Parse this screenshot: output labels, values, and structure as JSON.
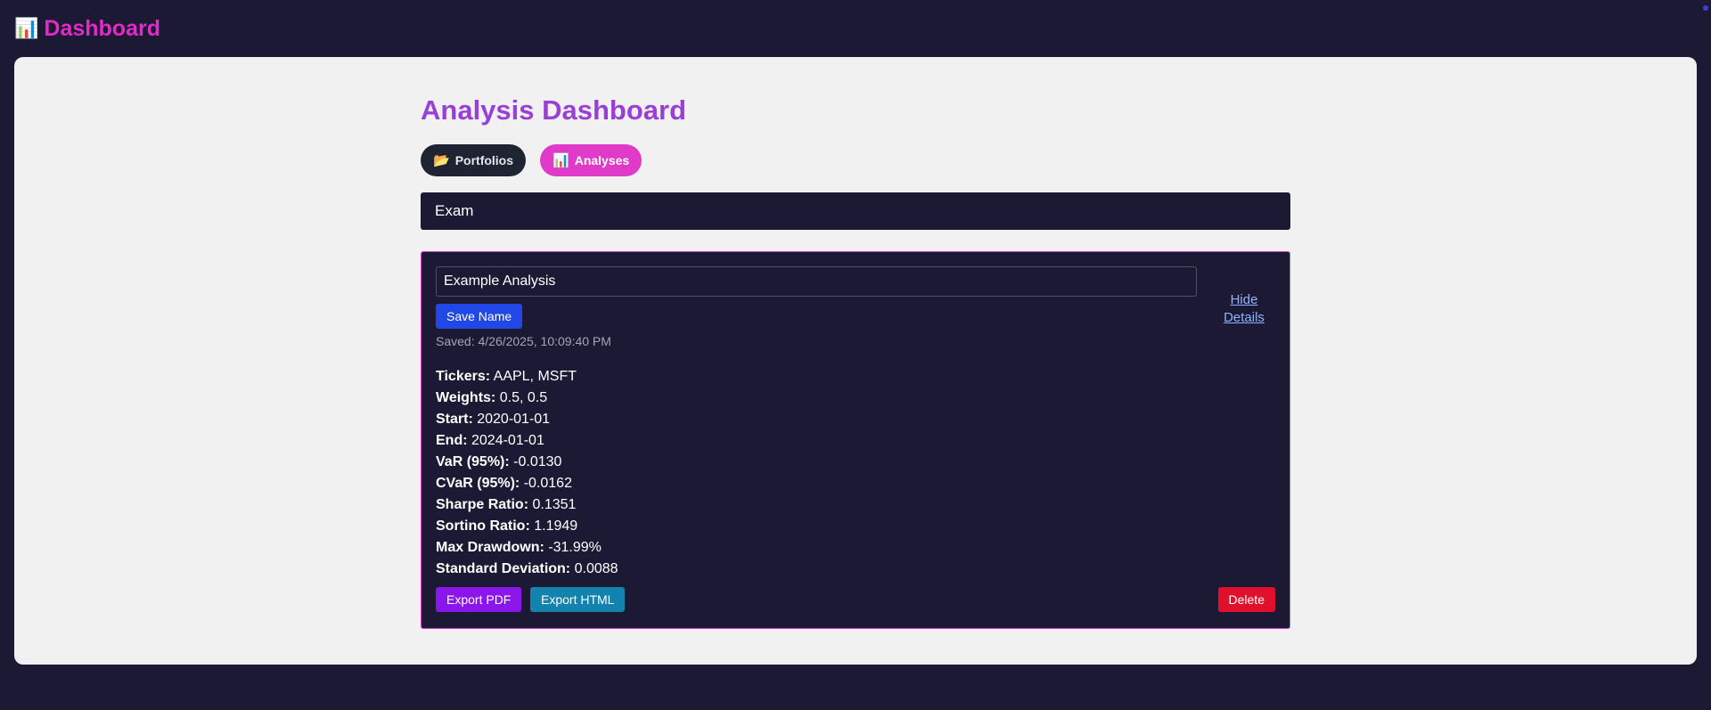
{
  "header": {
    "icon": "bar-chart-icon",
    "icon_glyph": "📊",
    "title": "Dashboard"
  },
  "main": {
    "title": "Analysis Dashboard",
    "tabs": [
      {
        "label": "Portfolios",
        "icon": "folder-icon",
        "icon_glyph": "📂",
        "active": false
      },
      {
        "label": "Analyses",
        "icon": "bar-chart-icon",
        "icon_glyph": "📊",
        "active": true
      }
    ],
    "filter_value": "Exam"
  },
  "analysis_card": {
    "name_value": "Example Analysis",
    "save_label": "Save Name",
    "saved_text": "Saved: 4/26/2025, 10:09:40 PM",
    "toggle_label": "Hide Details",
    "metrics": [
      {
        "label": "Tickers:",
        "value": "AAPL, MSFT"
      },
      {
        "label": "Weights:",
        "value": "0.5, 0.5"
      },
      {
        "label": "Start:",
        "value": "2020-01-01"
      },
      {
        "label": "End:",
        "value": "2024-01-01"
      },
      {
        "label": "VaR (95%):",
        "value": "-0.0130"
      },
      {
        "label": "CVaR (95%):",
        "value": "-0.0162"
      },
      {
        "label": "Sharpe Ratio:",
        "value": "0.1351"
      },
      {
        "label": "Sortino Ratio:",
        "value": "1.1949"
      },
      {
        "label": "Max Drawdown:",
        "value": "-31.99%"
      },
      {
        "label": "Standard Deviation:",
        "value": "0.0088"
      }
    ],
    "export_pdf_label": "Export PDF",
    "export_html_label": "Export HTML",
    "delete_label": "Delete"
  },
  "colors": {
    "background": "#1b1934",
    "brand": "#e22ac7",
    "title": "#9a3fd6",
    "save": "#2148e6",
    "pdf": "#8a16ea",
    "html": "#1382ad",
    "delete": "#e0102c"
  }
}
